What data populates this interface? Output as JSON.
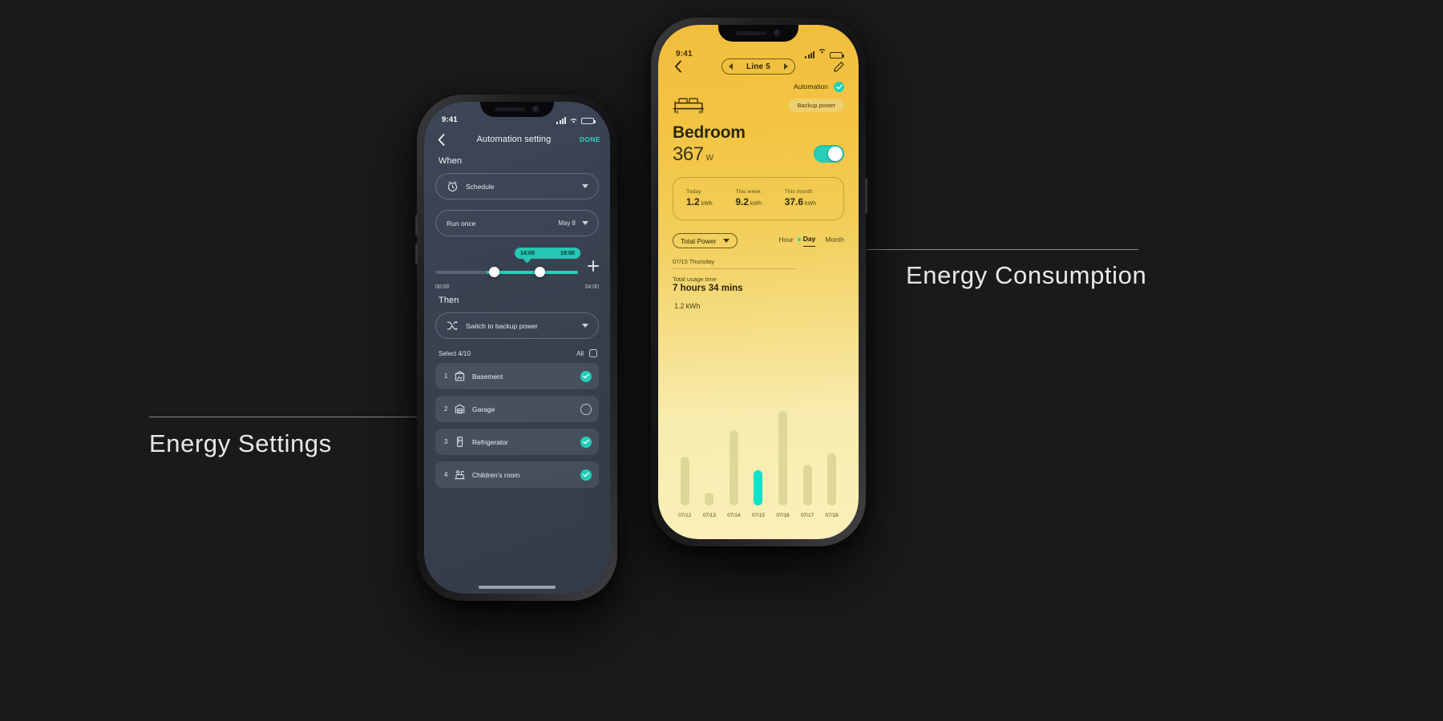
{
  "annotations": {
    "energy_settings": "Energy Settings",
    "energy_consumption": "Energy Consumption"
  },
  "left_phone": {
    "status_bar": {
      "time": "9:41"
    },
    "header": {
      "back_icon": "chevron-left-icon",
      "title": "Automation setting",
      "done_label": "DONE"
    },
    "when": {
      "section_label": "When",
      "trigger": {
        "icon": "alarm-clock-icon",
        "label": "Schedule"
      },
      "repeat": {
        "label": "Run once",
        "value": "May 8"
      }
    },
    "slider": {
      "start_time": "14:00",
      "end_time": "19:00",
      "axis_min": "00:00",
      "axis_max": "24:00",
      "add_icon": "plus-icon"
    },
    "then": {
      "section_label": "Then",
      "action": {
        "icon": "shuffle-icon",
        "label": "Switch to backup power"
      }
    },
    "device_list": {
      "select_count": "Select 4/10",
      "all_label": "All",
      "items": [
        {
          "num": "1",
          "name": "Basement",
          "icon": "basement-icon",
          "checked": true
        },
        {
          "num": "2",
          "name": "Garage",
          "icon": "garage-icon",
          "checked": false
        },
        {
          "num": "3",
          "name": "Refrigerator",
          "icon": "refrigerator-icon",
          "checked": true
        },
        {
          "num": "4",
          "name": "Children's room",
          "icon": "childrens-room-icon",
          "checked": true
        }
      ]
    }
  },
  "right_phone": {
    "status_bar": {
      "time": "9:41"
    },
    "header": {
      "back_icon": "chevron-left-icon",
      "line_label": "Line 5",
      "edit_icon": "edit-pencil-icon"
    },
    "automation": {
      "label": "Automation",
      "checked": true
    },
    "backup_power": {
      "label": "Backup power"
    },
    "room": {
      "icon": "bed-icon",
      "name": "Bedroom",
      "power_value": "367",
      "power_unit": "W",
      "toggle_on": true
    },
    "stats": [
      {
        "label": "Today",
        "value": "1.2",
        "unit": "kWh"
      },
      {
        "label": "This week",
        "value": "9.2",
        "unit": "kWh"
      },
      {
        "label": "This month",
        "value": "37.6",
        "unit": "kWh"
      }
    ],
    "chart_controls": {
      "metric_label": "Total Power",
      "metric_caret": "chevron-down-icon",
      "tabs": [
        {
          "label": "Hour",
          "active": false
        },
        {
          "label": "Day",
          "active": true
        },
        {
          "label": "Month",
          "active": false
        }
      ]
    },
    "detail": {
      "date": "07/15 Thursday",
      "usage_label": "Total usage time",
      "usage_value": "7 hours 34 mins",
      "kwh_value": "1.2",
      "kwh_unit": "kWh"
    },
    "chart_data": {
      "type": "bar",
      "title": "",
      "xlabel": "",
      "ylabel": "kWh",
      "categories": [
        "07/12",
        "07/13",
        "07/14",
        "07/15",
        "07/16",
        "07/17",
        "07/18"
      ],
      "values": [
        0.62,
        0.16,
        0.95,
        0.45,
        1.2,
        0.52,
        0.66
      ],
      "ylim": [
        0,
        1.3
      ],
      "grid": false,
      "legend": "none",
      "highlight_index": 3,
      "bar_color": "#ddd79a",
      "highlight_color": "#0fe3cb"
    }
  },
  "colors": {
    "accent_teal": "#23cfb8",
    "yellow_top": "#f2bd3e",
    "yellow_bottom": "#faf0b8",
    "dark_bg": "#1a1a1a",
    "slate": "#3d4658"
  }
}
